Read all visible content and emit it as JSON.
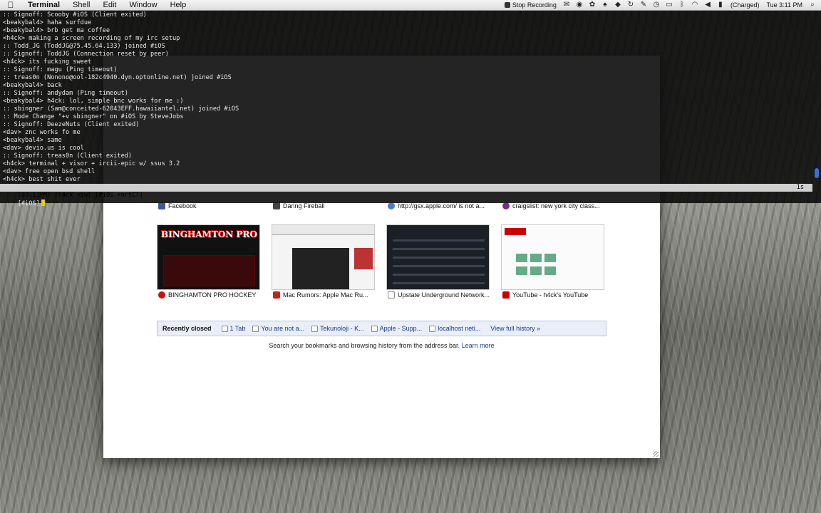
{
  "menubar": {
    "app_name": "Terminal",
    "items": [
      "Shell",
      "Edit",
      "Window",
      "Help"
    ],
    "stop_recording": "Stop Recording",
    "battery_status": "(Charged)",
    "clock": "Tue 3:11 PM"
  },
  "terminal": {
    "lines": [
      ":: Signoff: Scooby #iOS (Client exited)",
      "<beakybal4> haha surfdue",
      "<beakybal4> brb get ma coffee",
      "<h4ck> making a screen recording of my irc setup",
      ":: Todd_JG (ToddJG@75.45.64.133) joined #iOS",
      ":: Signoff: ToddJG (Connection reset by peer)",
      "<h4ck> its fucking sweet",
      ":: Signoff: magu (Ping timeout)",
      ":: treas0n (Nonono@ool-182c4940.dyn.optonline.net) joined #iOS",
      "<beakybal4> back",
      ":: Signoff: andydam (Ping timeout)",
      "<beakybal4> h4ck: lol, simple bnc works for me :)",
      ":: sbingner (Sam@conceited-62043EFF.hawaiiantel.net) joined #iOS",
      ":: Mode Change \"+v sbingner\" on #iOS by SteveJobs",
      ":: Signoff: DeezeNuts (Client exited)",
      "<dav> znc works fo me",
      "<beakybal4> same",
      "<dav> devio.us is cool",
      ":: Signoff: treas0n (Client exited)",
      "<h4ck> terminal + visor + ircii-epic w/ ssus 3.2",
      "<dav> free open bsd shell",
      "<h4ck> best shit ever"
    ],
    "status_bar": "[03:11PM] [h4ck +iw] [#iOS +nrtCT]",
    "status_right": "1s",
    "prompt": "[#iOS]"
  },
  "new_tab": {
    "top_labels": [
      {
        "label": "Facebook",
        "favicon_color": "#3b5998"
      },
      {
        "label": "Daring Fireball",
        "favicon_color": "#444444"
      },
      {
        "label": "http://gsx.apple.com/ is not a...",
        "favicon_color": "#4a7ad0"
      },
      {
        "label": "craigslist: new york city class...",
        "favicon_color": "#7a2a8a"
      }
    ],
    "thumbnails": [
      {
        "label": "BINGHAMTON PRO HOCKEY",
        "title_text": "BINGHAMTON PRO",
        "favicon_color": "#cc1111"
      },
      {
        "label": "Mac Rumors: Apple Mac Ru...",
        "favicon_color": "#c02222"
      },
      {
        "label": "Upstate Underground Network...",
        "favicon_color": "#888888"
      },
      {
        "label": "YouTube - h4ck's YouTube",
        "favicon_color": "#cc0000"
      }
    ],
    "recently_closed": {
      "title": "Recently closed",
      "items": [
        "1 Tab",
        "You are not a...",
        "Tekunoloji - K...",
        "Apple - Supp...",
        "localhost neti..."
      ],
      "history_link": "View full history »"
    },
    "search_hint": "Search your bookmarks and browsing history from the address bar.",
    "learn_more": "Learn more"
  }
}
